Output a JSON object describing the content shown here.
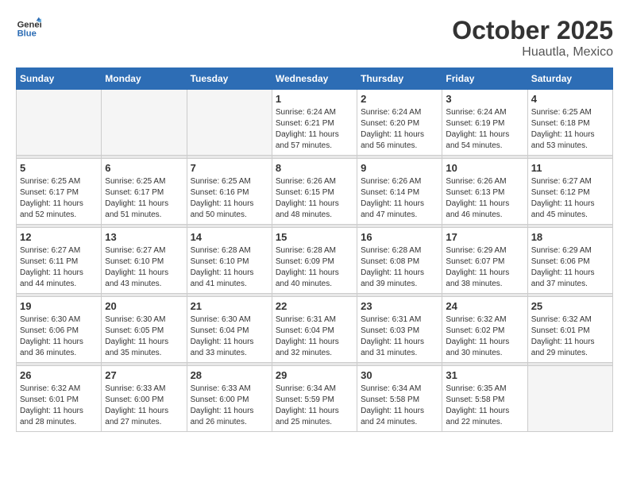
{
  "header": {
    "logo_line1": "General",
    "logo_line2": "Blue",
    "month": "October 2025",
    "location": "Huautla, Mexico"
  },
  "days_of_week": [
    "Sunday",
    "Monday",
    "Tuesday",
    "Wednesday",
    "Thursday",
    "Friday",
    "Saturday"
  ],
  "weeks": [
    [
      {
        "day": "",
        "sunrise": "",
        "sunset": "",
        "daylight": ""
      },
      {
        "day": "",
        "sunrise": "",
        "sunset": "",
        "daylight": ""
      },
      {
        "day": "",
        "sunrise": "",
        "sunset": "",
        "daylight": ""
      },
      {
        "day": "1",
        "sunrise": "Sunrise: 6:24 AM",
        "sunset": "Sunset: 6:21 PM",
        "daylight": "Daylight: 11 hours and 57 minutes."
      },
      {
        "day": "2",
        "sunrise": "Sunrise: 6:24 AM",
        "sunset": "Sunset: 6:20 PM",
        "daylight": "Daylight: 11 hours and 56 minutes."
      },
      {
        "day": "3",
        "sunrise": "Sunrise: 6:24 AM",
        "sunset": "Sunset: 6:19 PM",
        "daylight": "Daylight: 11 hours and 54 minutes."
      },
      {
        "day": "4",
        "sunrise": "Sunrise: 6:25 AM",
        "sunset": "Sunset: 6:18 PM",
        "daylight": "Daylight: 11 hours and 53 minutes."
      }
    ],
    [
      {
        "day": "5",
        "sunrise": "Sunrise: 6:25 AM",
        "sunset": "Sunset: 6:17 PM",
        "daylight": "Daylight: 11 hours and 52 minutes."
      },
      {
        "day": "6",
        "sunrise": "Sunrise: 6:25 AM",
        "sunset": "Sunset: 6:17 PM",
        "daylight": "Daylight: 11 hours and 51 minutes."
      },
      {
        "day": "7",
        "sunrise": "Sunrise: 6:25 AM",
        "sunset": "Sunset: 6:16 PM",
        "daylight": "Daylight: 11 hours and 50 minutes."
      },
      {
        "day": "8",
        "sunrise": "Sunrise: 6:26 AM",
        "sunset": "Sunset: 6:15 PM",
        "daylight": "Daylight: 11 hours and 48 minutes."
      },
      {
        "day": "9",
        "sunrise": "Sunrise: 6:26 AM",
        "sunset": "Sunset: 6:14 PM",
        "daylight": "Daylight: 11 hours and 47 minutes."
      },
      {
        "day": "10",
        "sunrise": "Sunrise: 6:26 AM",
        "sunset": "Sunset: 6:13 PM",
        "daylight": "Daylight: 11 hours and 46 minutes."
      },
      {
        "day": "11",
        "sunrise": "Sunrise: 6:27 AM",
        "sunset": "Sunset: 6:12 PM",
        "daylight": "Daylight: 11 hours and 45 minutes."
      }
    ],
    [
      {
        "day": "12",
        "sunrise": "Sunrise: 6:27 AM",
        "sunset": "Sunset: 6:11 PM",
        "daylight": "Daylight: 11 hours and 44 minutes."
      },
      {
        "day": "13",
        "sunrise": "Sunrise: 6:27 AM",
        "sunset": "Sunset: 6:10 PM",
        "daylight": "Daylight: 11 hours and 43 minutes."
      },
      {
        "day": "14",
        "sunrise": "Sunrise: 6:28 AM",
        "sunset": "Sunset: 6:10 PM",
        "daylight": "Daylight: 11 hours and 41 minutes."
      },
      {
        "day": "15",
        "sunrise": "Sunrise: 6:28 AM",
        "sunset": "Sunset: 6:09 PM",
        "daylight": "Daylight: 11 hours and 40 minutes."
      },
      {
        "day": "16",
        "sunrise": "Sunrise: 6:28 AM",
        "sunset": "Sunset: 6:08 PM",
        "daylight": "Daylight: 11 hours and 39 minutes."
      },
      {
        "day": "17",
        "sunrise": "Sunrise: 6:29 AM",
        "sunset": "Sunset: 6:07 PM",
        "daylight": "Daylight: 11 hours and 38 minutes."
      },
      {
        "day": "18",
        "sunrise": "Sunrise: 6:29 AM",
        "sunset": "Sunset: 6:06 PM",
        "daylight": "Daylight: 11 hours and 37 minutes."
      }
    ],
    [
      {
        "day": "19",
        "sunrise": "Sunrise: 6:30 AM",
        "sunset": "Sunset: 6:06 PM",
        "daylight": "Daylight: 11 hours and 36 minutes."
      },
      {
        "day": "20",
        "sunrise": "Sunrise: 6:30 AM",
        "sunset": "Sunset: 6:05 PM",
        "daylight": "Daylight: 11 hours and 35 minutes."
      },
      {
        "day": "21",
        "sunrise": "Sunrise: 6:30 AM",
        "sunset": "Sunset: 6:04 PM",
        "daylight": "Daylight: 11 hours and 33 minutes."
      },
      {
        "day": "22",
        "sunrise": "Sunrise: 6:31 AM",
        "sunset": "Sunset: 6:04 PM",
        "daylight": "Daylight: 11 hours and 32 minutes."
      },
      {
        "day": "23",
        "sunrise": "Sunrise: 6:31 AM",
        "sunset": "Sunset: 6:03 PM",
        "daylight": "Daylight: 11 hours and 31 minutes."
      },
      {
        "day": "24",
        "sunrise": "Sunrise: 6:32 AM",
        "sunset": "Sunset: 6:02 PM",
        "daylight": "Daylight: 11 hours and 30 minutes."
      },
      {
        "day": "25",
        "sunrise": "Sunrise: 6:32 AM",
        "sunset": "Sunset: 6:01 PM",
        "daylight": "Daylight: 11 hours and 29 minutes."
      }
    ],
    [
      {
        "day": "26",
        "sunrise": "Sunrise: 6:32 AM",
        "sunset": "Sunset: 6:01 PM",
        "daylight": "Daylight: 11 hours and 28 minutes."
      },
      {
        "day": "27",
        "sunrise": "Sunrise: 6:33 AM",
        "sunset": "Sunset: 6:00 PM",
        "daylight": "Daylight: 11 hours and 27 minutes."
      },
      {
        "day": "28",
        "sunrise": "Sunrise: 6:33 AM",
        "sunset": "Sunset: 6:00 PM",
        "daylight": "Daylight: 11 hours and 26 minutes."
      },
      {
        "day": "29",
        "sunrise": "Sunrise: 6:34 AM",
        "sunset": "Sunset: 5:59 PM",
        "daylight": "Daylight: 11 hours and 25 minutes."
      },
      {
        "day": "30",
        "sunrise": "Sunrise: 6:34 AM",
        "sunset": "Sunset: 5:58 PM",
        "daylight": "Daylight: 11 hours and 24 minutes."
      },
      {
        "day": "31",
        "sunrise": "Sunrise: 6:35 AM",
        "sunset": "Sunset: 5:58 PM",
        "daylight": "Daylight: 11 hours and 22 minutes."
      },
      {
        "day": "",
        "sunrise": "",
        "sunset": "",
        "daylight": ""
      }
    ]
  ]
}
